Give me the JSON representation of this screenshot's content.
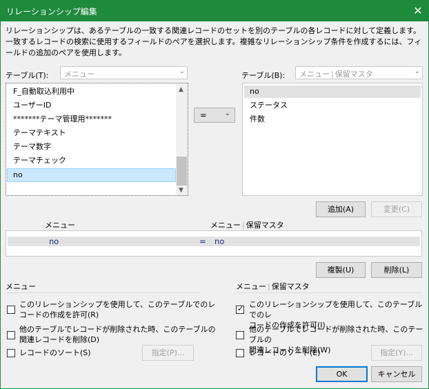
{
  "title": "リレーションシップ編集",
  "close_glyph": "✕",
  "description": "リレーションシップは、あるテーブルの一致する関連レコードのセットを別のテーブルの各レコードに対して定義します。一致するレコードの検索に使用するフィールドのペアを選択します。複雑なリレーションシップ条件を作成するには、フィールドの追加のペアを使用します。",
  "left_table": {
    "label": "テーブル(T):",
    "value": "メニュー",
    "fields": [
      "F_自動取込利用中",
      "ユーザーID",
      "*******テーマ管理用*******",
      "テーマテキスト",
      "テーマ数字",
      "テーマチェック",
      "no"
    ],
    "selected": "no"
  },
  "operator": "=",
  "right_table": {
    "label": "テーブル(B):",
    "value_a": "メニュー",
    "value_b": "保留マスタ",
    "fields": [
      "no",
      "ステータス",
      "件数"
    ],
    "selected": "no"
  },
  "buttons": {
    "add": "追加(A)",
    "change": "変更(C)",
    "duplicate": "複製(U)",
    "delete": "削除(L)",
    "ok": "OK",
    "cancel": "キャンセル",
    "specify_left": "指定(P)...",
    "specify_right": "指定(Y)..."
  },
  "relation_list": {
    "left_header": "メニュー",
    "right_header_a": "メニュー",
    "right_header_b": "保留マスタ",
    "rows": [
      {
        "left": "no",
        "op": "=",
        "right": "no"
      }
    ]
  },
  "left_options": {
    "header": "メニュー",
    "allow_create": {
      "line1": "このリレーションシップを使用して、このテーブルでのレ",
      "line2": "コードの作成を許可(R)",
      "checked": false
    },
    "delete_related": {
      "line1": "他のテーブルでレコードが削除された時、このテーブルの",
      "line2": "関連レコードを削除(D)",
      "checked": false
    },
    "sort": {
      "label": "レコードのソート(S)",
      "checked": false
    }
  },
  "right_options": {
    "header_a": "メニュー",
    "header_b": "保留マスタ",
    "allow_create": {
      "line1": "このリレーションシップを使用して、このテーブルでのレ",
      "line2": "コードの作成を許可(I)",
      "checked": true
    },
    "delete_related": {
      "line1": "他のテーブルでレコードが削除された時、このテーブルの",
      "line2": "関連レコードを削除(W)",
      "checked": false
    },
    "sort": {
      "label": "レコードのソート(E)",
      "checked": false
    }
  },
  "colors": {
    "titlebar": "#1e8a3c",
    "selection": "#cce8ff",
    "text_navy": "#1a2a88"
  }
}
